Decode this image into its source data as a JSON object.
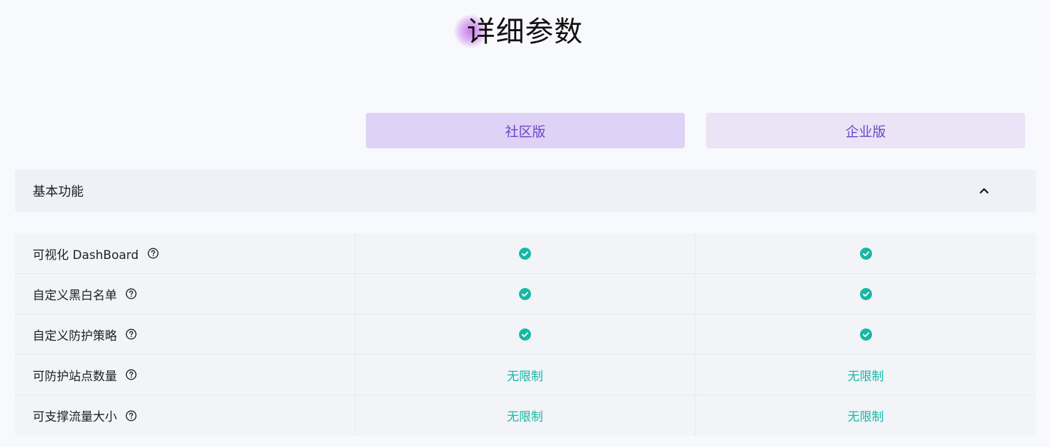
{
  "page": {
    "title": "详细参数"
  },
  "plans": {
    "community": "社区版",
    "enterprise": "企业版"
  },
  "section": {
    "title": "基本功能",
    "collapse_icon": "chevron-up-icon"
  },
  "features": [
    {
      "name": "可视化 DashBoard",
      "community": "check",
      "enterprise": "check"
    },
    {
      "name": "自定义黑白名单",
      "community": "check",
      "enterprise": "check"
    },
    {
      "name": "自定义防护策略",
      "community": "check",
      "enterprise": "check"
    },
    {
      "name": "可防护站点数量",
      "community": "无限制",
      "enterprise": "无限制"
    },
    {
      "name": "可支撑流量大小",
      "community": "无限制",
      "enterprise": "无限制"
    }
  ],
  "icons": {
    "help": "question-circle-icon",
    "check": "check-circle-icon"
  },
  "colors": {
    "accent_purple": "#6a45c7",
    "community_bg": "#ded2f6",
    "enterprise_bg": "#ebe4f6",
    "check_green": "#17b7a4"
  }
}
